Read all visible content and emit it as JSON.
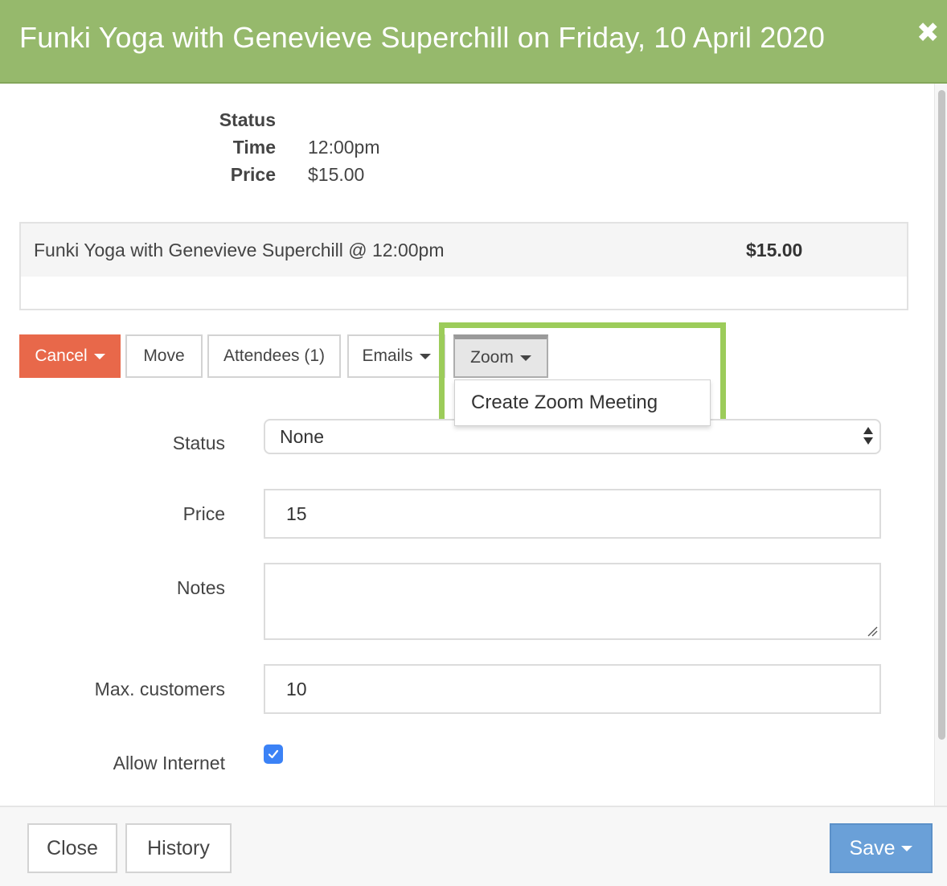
{
  "header": {
    "title": "Funki Yoga with Genevieve Superchill on Friday, 10 April 2020",
    "close_glyph": "✖"
  },
  "info": {
    "status_label": "Status",
    "time_label": "Time",
    "time_value": "12:00pm",
    "price_label": "Price",
    "price_value": "$15.00"
  },
  "summary": {
    "name": "Funki Yoga with Genevieve Superchill @ 12:00pm",
    "price": "$15.00"
  },
  "actions": {
    "cancel": "Cancel",
    "move": "Move",
    "attendees": "Attendees (1)",
    "emails": "Emails",
    "zoom": "Zoom",
    "zoom_menu": [
      "Create Zoom Meeting"
    ]
  },
  "form": {
    "status_label": "Status",
    "status_value": "None",
    "price_label": "Price",
    "price_value": "15",
    "notes_label": "Notes",
    "notes_value": "",
    "max_label": "Max. customers",
    "max_value": "10",
    "internet_label": "Allow Internet",
    "internet_checked": true
  },
  "footer": {
    "close": "Close",
    "history": "History",
    "save": "Save"
  },
  "colors": {
    "header_bg": "#96b96c",
    "cancel_bg": "#e8684a",
    "save_bg": "#6aa0d8",
    "highlight": "#9ccc5a",
    "checkbox": "#3b82f6"
  }
}
